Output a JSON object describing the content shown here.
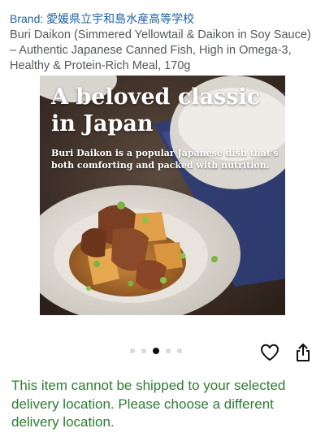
{
  "brand": {
    "text": "Brand: 愛媛県立宇和島水産高等学校"
  },
  "product": {
    "title": "Buri Daikon (Simmered Yellowtail & Daikon in Soy Sauce) – Authentic Japanese Canned Fish, High in Omega-3, Healthy & Protein-Rich Meal, 170g"
  },
  "image": {
    "headline": "A beloved classic in Japan",
    "subline": "Buri Daikon is a popular Japanese dish that's both comforting and packed with nutrition."
  },
  "carousel": {
    "count": 5,
    "active_index": 2
  },
  "actions": {
    "favorite_icon": "heart-icon",
    "share_icon": "share-icon"
  },
  "shipping_notice": "This item cannot be shipped to your selected delivery location. Please choose a different delivery location.",
  "colors": {
    "brand_link": "#2162a1",
    "notice": "#2e7d32",
    "active_dot": "#0f1111",
    "inactive_dot": "#d5d9d9"
  }
}
